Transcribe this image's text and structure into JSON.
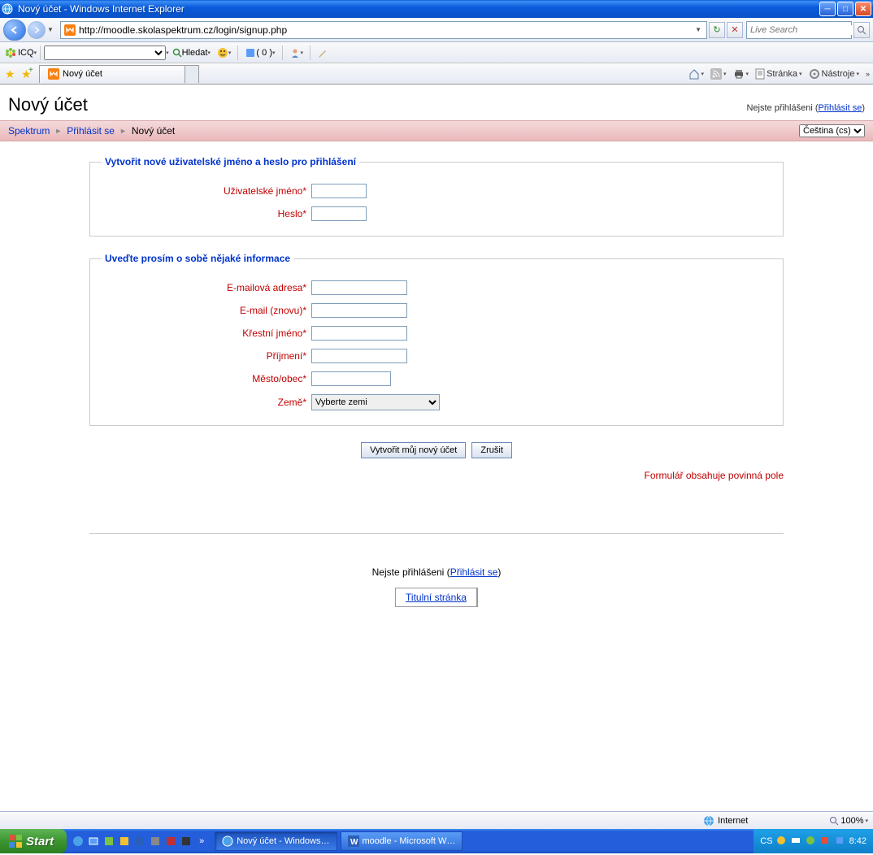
{
  "window": {
    "title": "Nový účet - Windows Internet Explorer"
  },
  "nav": {
    "url": "http://moodle.skolaspektrum.cz/login/signup.php",
    "search_placeholder": "Live Search"
  },
  "icqbar": {
    "brand": "ICQ",
    "search_btn": "Hledat",
    "counter": "( 0 )"
  },
  "tabs": {
    "active": "Nový účet"
  },
  "cmdbar": {
    "page": "Stránka",
    "tools": "Nástroje"
  },
  "page": {
    "title": "Nový účet",
    "login_status": "Nejste přihlášeni",
    "login_link": "Přihlásit se",
    "breadcrumb": {
      "root": "Spektrum",
      "login": "Přihlásit se",
      "current": "Nový účet"
    },
    "lang_selected": "Čeština (cs)"
  },
  "form": {
    "section1_legend": "Vytvořit nové uživatelské jméno a heslo pro přihlášení",
    "section2_legend": "Uveďte prosím o sobě nějaké informace",
    "labels": {
      "username": "Uživatelské jméno",
      "password": "Heslo",
      "email": "E-mailová adresa",
      "email2": "E-mail (znovu)",
      "firstname": "Křestní jméno",
      "lastname": "Příjmení",
      "city": "Město/obec",
      "country": "Země"
    },
    "country_placeholder": "Vyberte zemi",
    "submit": "Vytvořit můj nový účet",
    "cancel": "Zrušit",
    "required_note": "Formulář obsahuje povinná pole"
  },
  "footer": {
    "login_status": "Nejste přihlášeni",
    "login_link": "Přihlásit se",
    "home": "Titulní stránka"
  },
  "statusbar": {
    "zone": "Internet",
    "zoom": "100%"
  },
  "taskbar": {
    "start": "Start",
    "task1": "Nový účet - Windows…",
    "task2": "moodle - Microsoft W…",
    "lang": "CS",
    "clock": "8:42"
  }
}
